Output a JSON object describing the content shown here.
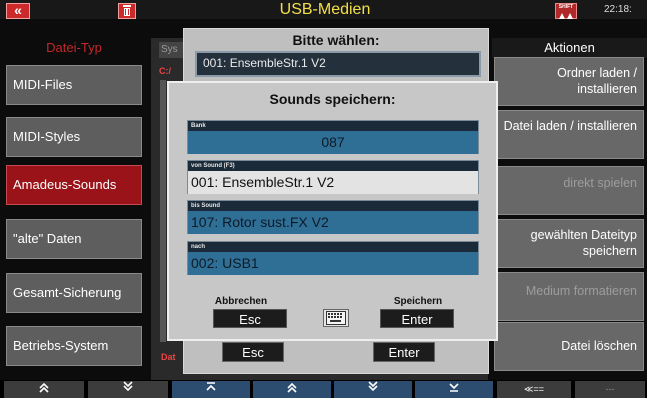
{
  "topbar": {
    "back_label": "«",
    "trash_label": "🗑",
    "title": "USB-Medien",
    "shift_label": "SHIFT",
    "clock": "22:18:"
  },
  "left": {
    "header": "Datei-Typ",
    "items": [
      {
        "label": "MIDI-Files"
      },
      {
        "label": "MIDI-Styles"
      },
      {
        "label": "Amadeus-Sounds"
      },
      {
        "label": "\"alte\" Daten"
      },
      {
        "label": "Gesamt-Sicherung"
      },
      {
        "label": "Betriebs-System"
      }
    ]
  },
  "right": {
    "header": "Aktionen",
    "items": [
      {
        "label": "Ordner laden / installieren"
      },
      {
        "label": "Datei laden / installieren"
      },
      {
        "label": "direkt spielen"
      },
      {
        "label": "gewählten Dateityp speichern"
      },
      {
        "label": "Medium formatieren"
      },
      {
        "label": "Datei löschen"
      }
    ]
  },
  "middle": {
    "sy_tab": "Sys",
    "path_tag": "C:/",
    "da_tag": "Dat"
  },
  "outer_dialog": {
    "title": "Bitte wählen:",
    "field_value": "001: EnsembleStr.1 V2",
    "esc_label": "Esc",
    "enter_label": "Enter"
  },
  "inner_dialog": {
    "title": "Sounds speichern:",
    "fields": [
      {
        "label": "Bank",
        "value": "087"
      },
      {
        "label": "von Sound (F3)",
        "value": "001: EnsembleStr.1 V2"
      },
      {
        "label": "bis Sound",
        "value": "107: Rotor sust.FX V2"
      },
      {
        "label": "nach",
        "value": "002: USB1"
      }
    ],
    "cancel_label": "Abbrechen",
    "cancel_key": "Esc",
    "save_label": "Speichern",
    "save_key": "Enter",
    "keyboard_icon": "keyboard-icon"
  },
  "bottom_nav": {
    "items": [
      "≫",
      "≫",
      "⌃",
      "≫",
      "≫",
      "⌄",
      "≪==",
      "---"
    ]
  },
  "colors": {
    "selected_red": "#9a1318",
    "title_yellow": "#f3e04a",
    "field_blue": "#2f6f96"
  }
}
